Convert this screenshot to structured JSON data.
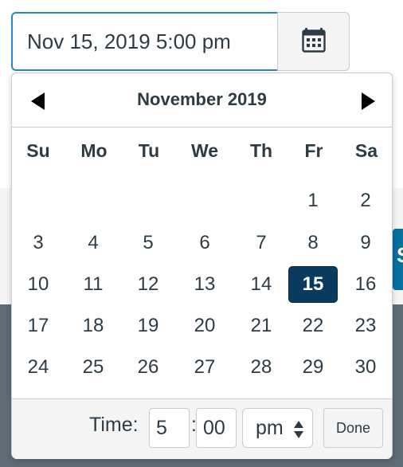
{
  "date_input": {
    "value": "Nov 15, 2019 5:00 pm"
  },
  "calendar_button": {
    "icon": "calendar-icon"
  },
  "background_button": {
    "label": "S"
  },
  "calendar": {
    "month_title": "November 2019",
    "prev_icon": "triangle-left-icon",
    "next_icon": "triangle-right-icon",
    "weekdays": [
      "Su",
      "Mo",
      "Tu",
      "We",
      "Th",
      "Fr",
      "Sa"
    ],
    "weeks": [
      [
        "",
        "",
        "",
        "",
        "",
        "1",
        "2"
      ],
      [
        "3",
        "4",
        "5",
        "6",
        "7",
        "8",
        "9"
      ],
      [
        "10",
        "11",
        "12",
        "13",
        "14",
        "15",
        "16"
      ],
      [
        "17",
        "18",
        "19",
        "20",
        "21",
        "22",
        "23"
      ],
      [
        "24",
        "25",
        "26",
        "27",
        "28",
        "29",
        "30"
      ]
    ],
    "selected_day": "15",
    "selected_color": "#0a3a5e"
  },
  "time": {
    "label": "Time:",
    "hour": "5",
    "separator": ":",
    "minute": "00",
    "ampm": "pm",
    "done_label": "Done"
  },
  "colors": {
    "focus_border": "#2d86c4",
    "text": "#2d3b45",
    "brand_blue": "#0770a3"
  }
}
